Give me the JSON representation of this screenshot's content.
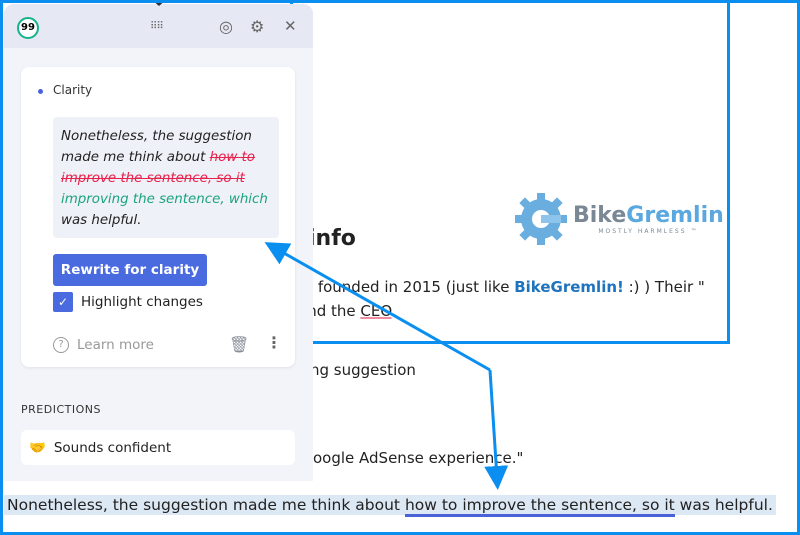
{
  "page": {
    "heading_fragment": "y info",
    "line1_pre": "re founded in 2015 (just like ",
    "line1_link": "BikeGremlin!",
    "line1_post": " :)  ) Their \"",
    "line2_pre": "and the ",
    "line2_ceo": "CEO",
    "line2_post": ".",
    "line3": "sing suggestion",
    "line4": "oogle AdSense experience.\"",
    "logo": {
      "name_a": "Bike",
      "name_b": "Gremlin",
      "tagline": "MOSTLY HARMLESS ™"
    },
    "sentence": {
      "pre": "Nonetheless, the suggestion made me think about ",
      "flagged": "how to improve the sentence, so it",
      "post": " was helpful."
    }
  },
  "panel": {
    "logo_text": "99",
    "header_icons": [
      "drag-handle-icon",
      "goals-target-icon",
      "gear-icon",
      "close-icon"
    ],
    "card": {
      "category": "Clarity",
      "suggestion": {
        "plain1": "Nonetheless, the suggestion made me think about ",
        "deleted": "how to improve the sentence, so it",
        "inserted": "improving the sentence, which",
        "plain2": " was helpful."
      },
      "rewrite_button": "Rewrite for clarity",
      "highlight_label": "Highlight changes",
      "highlight_checked": true,
      "learn_more": "Learn more"
    },
    "predictions_label": "PREDICTIONS",
    "prediction": "Sounds confident"
  },
  "colors": {
    "annotation": "#0a8ff0",
    "accent": "#4a6ae0",
    "deleted": "#e8214c",
    "inserted": "#1aa37e"
  }
}
